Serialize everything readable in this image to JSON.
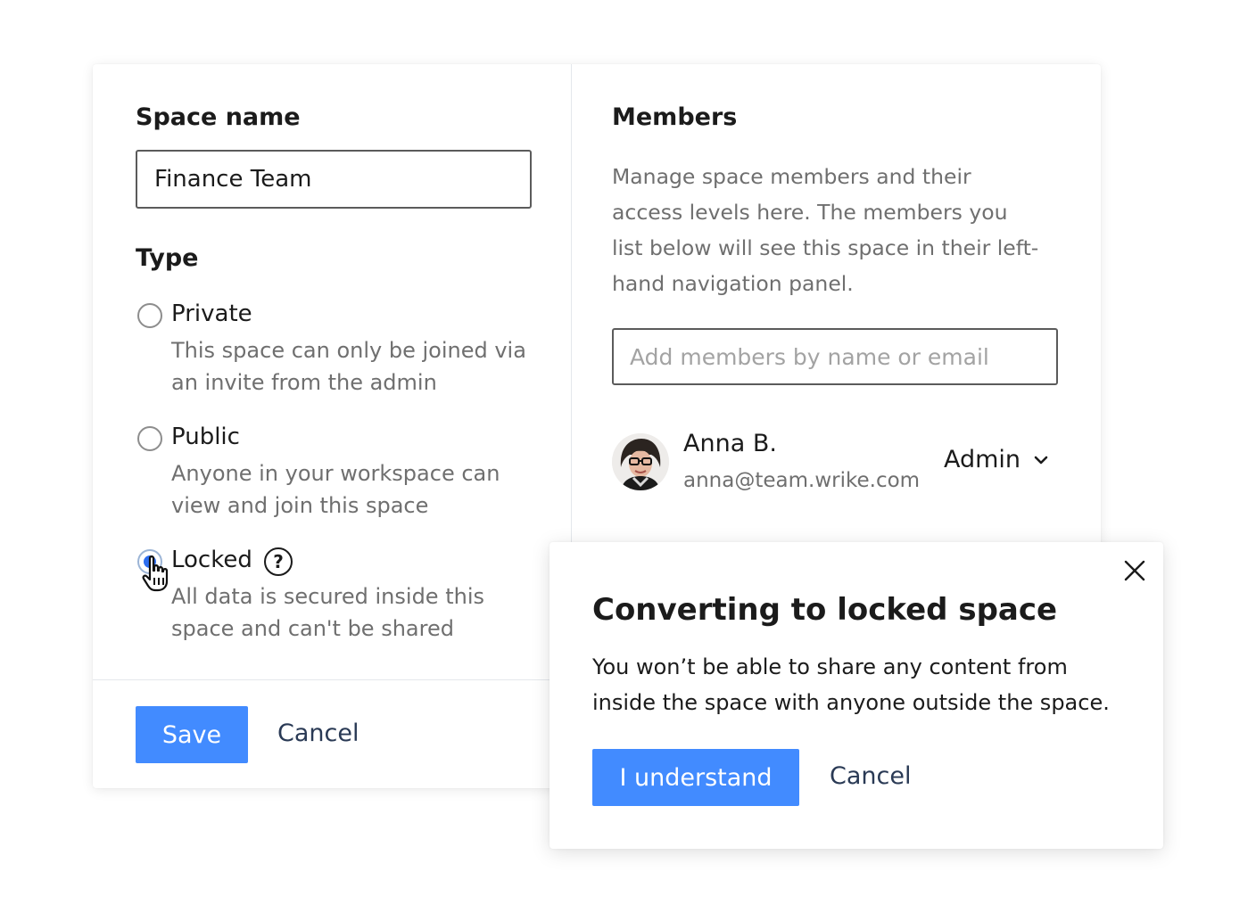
{
  "left_panel": {
    "space_name_label": "Space name",
    "space_name_value": "Finance Team",
    "type_label": "Type",
    "options": [
      {
        "label": "Private",
        "description": "This space can only be joined via an invite from the admin",
        "selected": false
      },
      {
        "label": "Public",
        "description": "Anyone in your workspace can view and join this space",
        "selected": false
      },
      {
        "label": "Locked",
        "description": "All data is secured inside this space and can't be shared",
        "selected": true
      }
    ],
    "help_icon_glyph": "?"
  },
  "members_panel": {
    "title": "Members",
    "description": "Manage space members and their access levels here. The members you list below will see this space in their left-hand navigation panel.",
    "search_placeholder": "Add members by name or email",
    "members": [
      {
        "name": "Anna B.",
        "email": "anna@team.wrike.com",
        "role": "Admin"
      }
    ]
  },
  "footer": {
    "save_label": "Save",
    "cancel_label": "Cancel"
  },
  "dialog": {
    "title": "Converting to locked space",
    "text": "You won’t be able to share any content from inside the space with anyone outside the space.",
    "confirm_label": "I understand",
    "cancel_label": "Cancel"
  },
  "colors": {
    "primary": "#428bff",
    "radio_selected": "#2d6ef0",
    "link": "#2a3a55"
  },
  "icons": {
    "help": "question-circle-icon",
    "cursor": "hand-pointer-icon",
    "chevron": "chevron-down-icon",
    "close": "close-icon"
  }
}
